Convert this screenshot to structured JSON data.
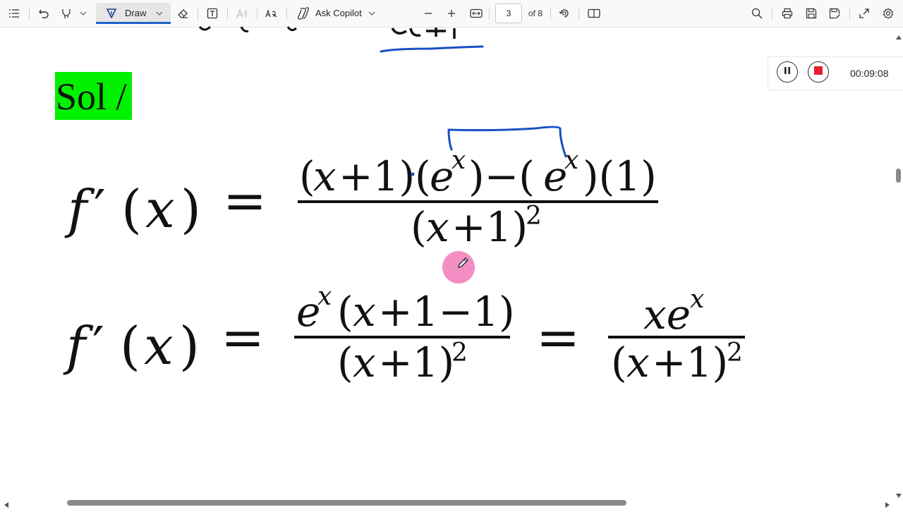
{
  "toolbar": {
    "draw_label": "Draw",
    "copilot_label": "Ask Copilot",
    "page_number": "3",
    "page_of": "of 8"
  },
  "recorder": {
    "time": "00:09:08"
  },
  "document": {
    "sol_label": "Sol /"
  },
  "colors": {
    "ink_blue": "#1a4fc4",
    "highlight_green": "#00f000",
    "cursor_pink": "#f07ab8",
    "accent": "#1f63c8"
  },
  "icons": [
    "contents-icon",
    "undo-icon",
    "highlighter-icon",
    "chevron-down-icon",
    "draw-icon",
    "eraser-icon",
    "text-box-icon",
    "read-aloud-icon",
    "translate-icon",
    "copilot-icon",
    "zoom-out-icon",
    "zoom-in-icon",
    "fit-width-icon",
    "rotate-icon",
    "page-view-icon",
    "search-icon",
    "print-icon",
    "save-icon",
    "save-as-icon",
    "fullscreen-icon",
    "settings-icon",
    "pause-icon",
    "stop-icon",
    "pencil-cursor-icon"
  ]
}
